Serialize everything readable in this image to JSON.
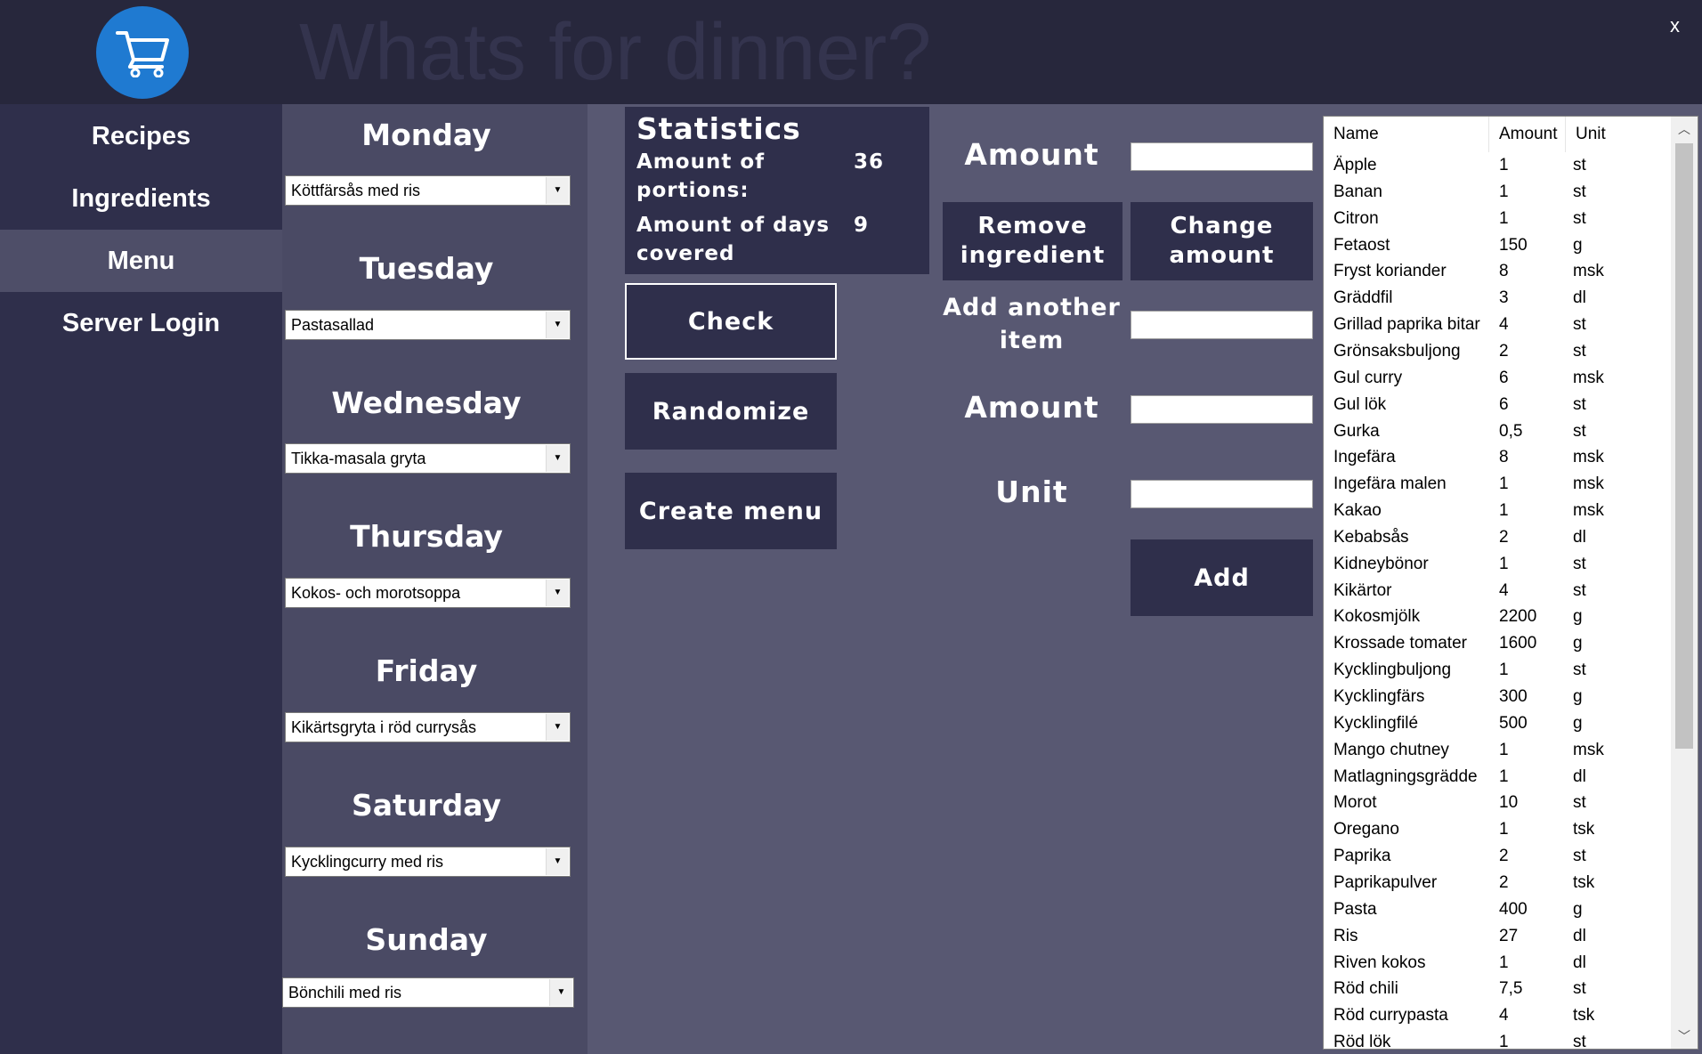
{
  "window": {
    "title": "Whats for dinner?",
    "close_label": "x"
  },
  "sidebar": {
    "items": [
      {
        "label": "Recipes"
      },
      {
        "label": "Ingredients"
      },
      {
        "label": "Menu"
      },
      {
        "label": "Server Login"
      }
    ],
    "active": "Menu"
  },
  "days": [
    {
      "label": "Monday",
      "selected": "Köttfärsås med ris"
    },
    {
      "label": "Tuesday",
      "selected": "Pastasallad"
    },
    {
      "label": "Wednesday",
      "selected": "Tikka-masala gryta"
    },
    {
      "label": "Thursday",
      "selected": "Kokos- och morotsoppa"
    },
    {
      "label": "Friday",
      "selected": "Kikärtsgryta i röd currysås"
    },
    {
      "label": "Saturday",
      "selected": "Kycklingcurry med ris"
    },
    {
      "label": "Sunday",
      "selected": "Bönchili med ris"
    }
  ],
  "statistics": {
    "title": "Statistics",
    "portions_label_1": "Amount of",
    "portions_label_2": "portions:",
    "portions_value": "36",
    "days_label_1": "Amount of days",
    "days_label_2": "covered",
    "days_value": "9"
  },
  "actions": {
    "check": "Check",
    "randomize": "Randomize",
    "create_menu": "Create menu"
  },
  "form": {
    "amount_label": "Amount",
    "remove_label_1": "Remove",
    "remove_label_2": "ingredient",
    "change_label_1": "Change",
    "change_label_2": "amount",
    "add_another_label_1": "Add another",
    "add_another_label_2": "item",
    "amount2_label": "Amount",
    "unit_label": "Unit",
    "add_button": "Add"
  },
  "ingredients": {
    "columns": [
      "Name",
      "Amount",
      "Unit"
    ],
    "rows": [
      [
        "Äpple",
        "1",
        "st"
      ],
      [
        "Banan",
        "1",
        "st"
      ],
      [
        "Citron",
        "1",
        "st"
      ],
      [
        "Fetaost",
        "150",
        "g"
      ],
      [
        "Fryst koriander",
        "8",
        "msk"
      ],
      [
        "Gräddfil",
        "3",
        "dl"
      ],
      [
        "Grillad paprika bitar",
        "4",
        "st"
      ],
      [
        "Grönsaksbuljong",
        "2",
        "st"
      ],
      [
        "Gul curry",
        "6",
        "msk"
      ],
      [
        "Gul lök",
        "6",
        "st"
      ],
      [
        "Gurka",
        "0,5",
        "st"
      ],
      [
        "Ingefära",
        "8",
        "msk"
      ],
      [
        "Ingefära malen",
        "1",
        "msk"
      ],
      [
        "Kakao",
        "1",
        "msk"
      ],
      [
        "Kebabsås",
        "2",
        "dl"
      ],
      [
        "Kidneybönor",
        "1",
        "st"
      ],
      [
        "Kikärtor",
        "4",
        "st"
      ],
      [
        "Kokosmjölk",
        "2200",
        "g"
      ],
      [
        "Krossade tomater",
        "1600",
        "g"
      ],
      [
        "Kycklingbuljong",
        "1",
        "st"
      ],
      [
        "Kycklingfärs",
        "300",
        "g"
      ],
      [
        "Kycklingfilé",
        "500",
        "g"
      ],
      [
        "Mango chutney",
        "1",
        "msk"
      ],
      [
        "Matlagningsgrädde",
        "1",
        "dl"
      ],
      [
        "Morot",
        "10",
        "st"
      ],
      [
        "Oregano",
        "1",
        "tsk"
      ],
      [
        "Paprika",
        "2",
        "st"
      ],
      [
        "Paprikapulver",
        "2",
        "tsk"
      ],
      [
        "Pasta",
        "400",
        "g"
      ],
      [
        "Ris",
        "27",
        "dl"
      ],
      [
        "Riven kokos",
        "1",
        "dl"
      ],
      [
        "Röd chili",
        "7,5",
        "st"
      ],
      [
        "Röd currypasta",
        "4",
        "tsk"
      ],
      [
        "Röd lök",
        "1",
        "st"
      ]
    ]
  }
}
